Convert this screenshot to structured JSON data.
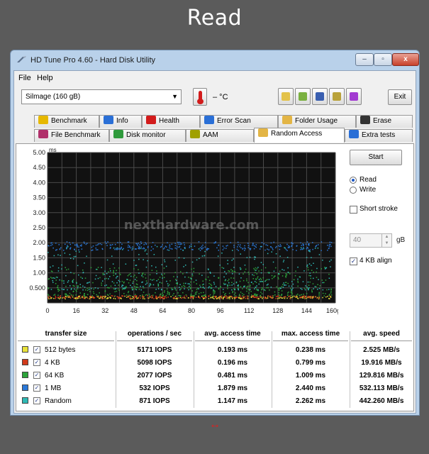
{
  "heading": "Read",
  "window": {
    "title": "HD Tune Pro 4.60 - Hard Disk Utility",
    "controls": {
      "minimize": "–",
      "maximize": "▫",
      "close": "x"
    }
  },
  "menu": {
    "file": "File",
    "help": "Help"
  },
  "toolbar": {
    "drive": "Silmage  (160 gB)",
    "temperature": "– °C",
    "exit": "Exit"
  },
  "tabs_row1": [
    {
      "label": "Benchmark",
      "icon": "trophy-icon",
      "color": "#e6b800"
    },
    {
      "label": "Info",
      "icon": "info-icon",
      "color": "#2a6fd6"
    },
    {
      "label": "Health",
      "icon": "health-cross-icon",
      "color": "#d21b1b"
    },
    {
      "label": "Error Scan",
      "icon": "magnifier-icon",
      "color": "#2a6fd6"
    },
    {
      "label": "Folder Usage",
      "icon": "folder-icon",
      "color": "#e3b545"
    },
    {
      "label": "Erase",
      "icon": "trash-icon",
      "color": "#333333"
    }
  ],
  "tabs_row2": [
    {
      "label": "File Benchmark",
      "icon": "file-benchmark-icon",
      "color": "#b0306a"
    },
    {
      "label": "Disk monitor",
      "icon": "disk-monitor-icon",
      "color": "#2f9a3c"
    },
    {
      "label": "AAM",
      "icon": "speaker-icon",
      "color": "#a0a000"
    },
    {
      "label": "Random Access",
      "icon": "random-access-icon",
      "color": "#e3b545",
      "active": true
    },
    {
      "label": "Extra tests",
      "icon": "extra-tests-icon",
      "color": "#2a6fd6"
    }
  ],
  "side": {
    "start": "Start",
    "read": "Read",
    "write": "Write",
    "short_stroke": "Short stroke",
    "short_stroke_value": "40",
    "unit": "gB",
    "align": "4 KB align"
  },
  "chart_data": {
    "type": "scatter",
    "title": "",
    "xlabel": "",
    "ylabel": "ms",
    "x_unit_label": "gB",
    "xlim": [
      0,
      160
    ],
    "ylim": [
      0,
      5
    ],
    "x_ticks": [
      "0",
      "16",
      "32",
      "48",
      "64",
      "80",
      "96",
      "112",
      "128",
      "144",
      "160"
    ],
    "y_ticks": [
      "5.00",
      "4.50",
      "4.00",
      "3.50",
      "3.00",
      "2.50",
      "2.00",
      "1.50",
      "1.00",
      "0.500"
    ],
    "grid": true,
    "background": "#111111",
    "watermark": "nexthardware.com",
    "series": [
      {
        "name": "512 bytes",
        "color": "#e8e23a",
        "band": [
          0.15,
          0.24
        ]
      },
      {
        "name": "4 KB",
        "color": "#d13a1b",
        "band": [
          0.16,
          0.26
        ]
      },
      {
        "name": "64 KB",
        "color": "#2ca33a",
        "band": [
          0.25,
          1.2
        ]
      },
      {
        "name": "1 MB",
        "color": "#2a78d8",
        "band": [
          1.75,
          2.05
        ]
      },
      {
        "name": "Random",
        "color": "#2fb9b5",
        "band": [
          0.45,
          1.9
        ]
      }
    ]
  },
  "table": {
    "headers": [
      "transfer size",
      "operations / sec",
      "avg. access time",
      "max. access time",
      "avg. speed"
    ],
    "rows": [
      {
        "name": "512 bytes",
        "color": "#e8e23a",
        "ops": "5171 IOPS",
        "avg": "0.193 ms",
        "max": "0.238 ms",
        "speed": "2.525 MB/s"
      },
      {
        "name": "4 KB",
        "color": "#d13a1b",
        "ops": "5098 IOPS",
        "avg": "0.196 ms",
        "max": "0.799 ms",
        "speed": "19.916 MB/s"
      },
      {
        "name": "64 KB",
        "color": "#2ca33a",
        "ops": "2077 IOPS",
        "avg": "0.481 ms",
        "max": "1.009 ms",
        "speed": "129.816 MB/s"
      },
      {
        "name": "1 MB",
        "color": "#2a78d8",
        "ops": "532 IOPS",
        "avg": "1.879 ms",
        "max": "2.440 ms",
        "speed": "532.113 MB/s"
      },
      {
        "name": "Random",
        "color": "#2fb9b5",
        "ops": "871 IOPS",
        "avg": "1.147 ms",
        "max": "2.262 ms",
        "speed": "442.260 MB/s"
      }
    ]
  },
  "resize_glyph": "↔"
}
